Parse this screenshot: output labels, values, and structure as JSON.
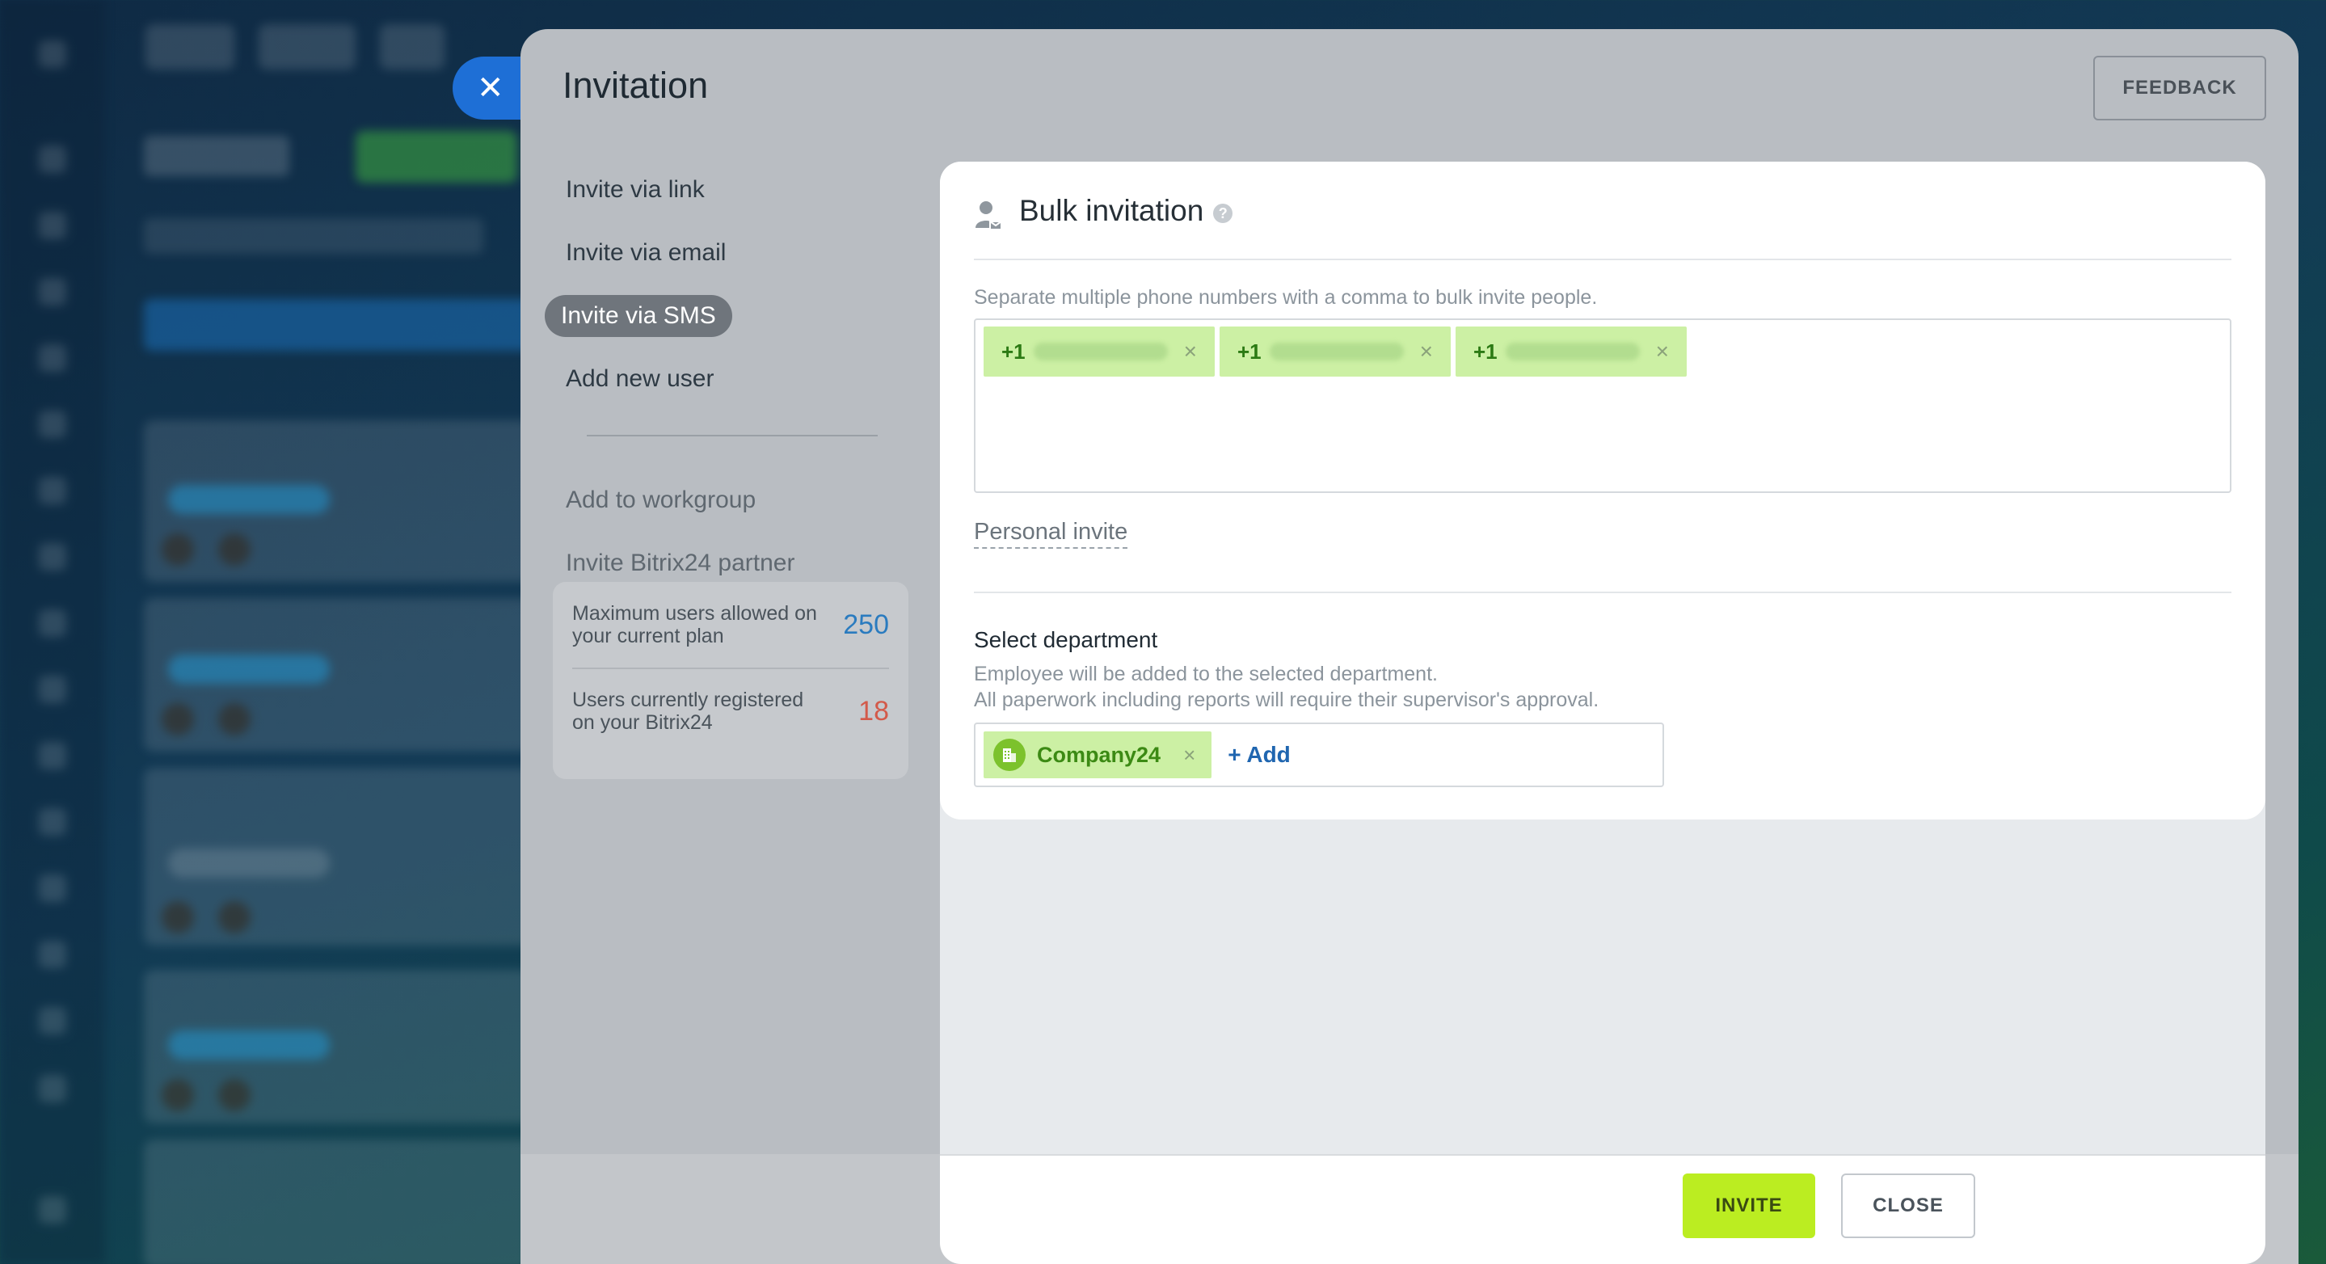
{
  "slider": {
    "title": "Invitation",
    "feedback_label": "FEEDBACK"
  },
  "menu": {
    "items": [
      {
        "label": "Invite via link"
      },
      {
        "label": "Invite via email"
      },
      {
        "label": "Invite via SMS",
        "active": true
      },
      {
        "label": "Add new user"
      }
    ],
    "secondary": [
      {
        "label": "Add to workgroup"
      },
      {
        "label": "Invite Bitrix24 partner"
      }
    ]
  },
  "limits": {
    "max_label": "Maximum users allowed on your current plan",
    "max_value": "250",
    "current_label": "Users currently registered on your Bitrix24",
    "current_value": "18"
  },
  "bulk": {
    "title": "Bulk invitation",
    "hint": "Separate multiple phone numbers with a comma to bulk invite people.",
    "phones": [
      {
        "code": "+1"
      },
      {
        "code": "+1"
      },
      {
        "code": "+1"
      }
    ],
    "personal_invite": "Personal invite"
  },
  "department": {
    "title": "Select department",
    "desc_line1": "Employee will be added to the selected department.",
    "desc_line2": "All paperwork including reports will require their supervisor's approval.",
    "selected": "Company24",
    "add_label": "+ Add"
  },
  "footer": {
    "invite_label": "INVITE",
    "close_label": "CLOSE"
  },
  "colors": {
    "accent_green": "#bbed21",
    "tag_green": "#ccf0a4",
    "link_blue": "#2066b0",
    "overlay_close_blue": "#1e6fd6"
  }
}
